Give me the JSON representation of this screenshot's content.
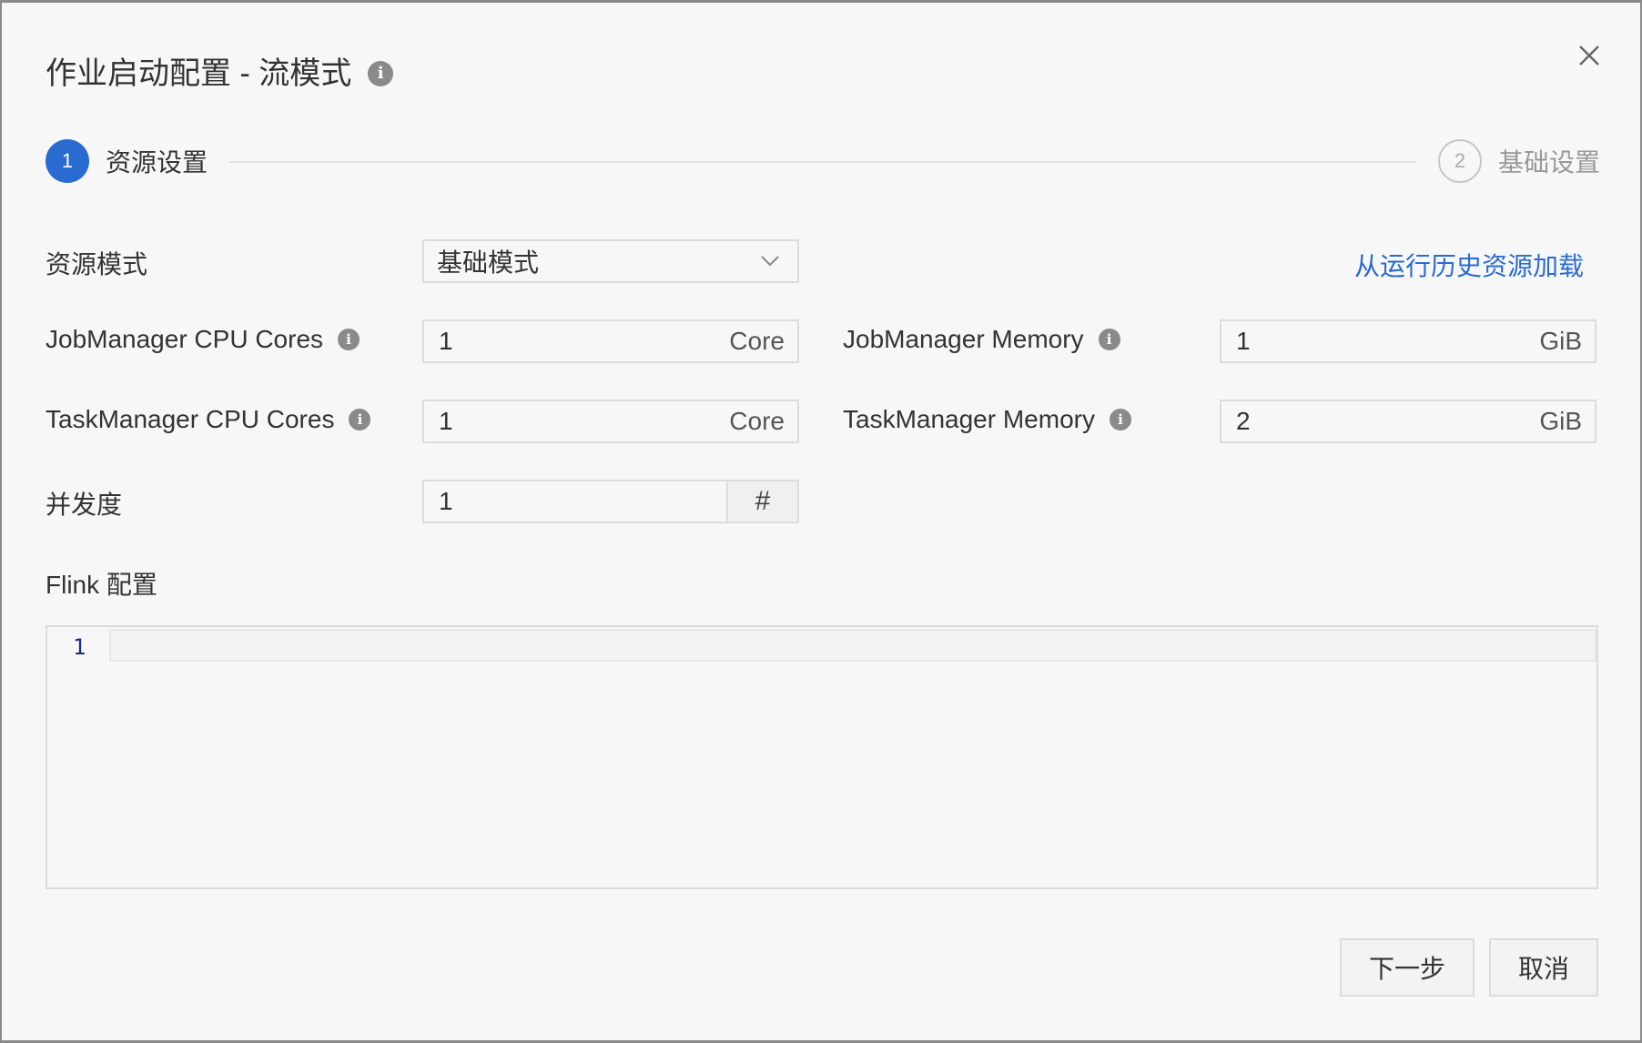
{
  "dialog": {
    "title": "作业启动配置 - 流模式",
    "title_info_icon": "info-icon",
    "close_icon": "close-icon"
  },
  "steps": [
    {
      "number": "1",
      "label": "资源设置",
      "active": true
    },
    {
      "number": "2",
      "label": "基础设置",
      "active": false
    }
  ],
  "form": {
    "resource_mode": {
      "label": "资源模式",
      "value": "基础模式",
      "icon": "chevron-down-icon"
    },
    "load_history_link": "从运行历史资源加载",
    "jm_cpu": {
      "label": "JobManager CPU Cores",
      "value": "1",
      "unit": "Core"
    },
    "jm_memory": {
      "label": "JobManager Memory",
      "value": "1",
      "unit": "GiB"
    },
    "tm_cpu": {
      "label": "TaskManager CPU Cores",
      "value": "1",
      "unit": "Core"
    },
    "tm_memory": {
      "label": "TaskManager Memory",
      "value": "2",
      "unit": "GiB"
    },
    "parallelism": {
      "label": "并发度",
      "value": "1",
      "button_symbol": "#"
    },
    "flink_config": {
      "label": "Flink 配置",
      "line_number": "1"
    }
  },
  "footer": {
    "next_label": "下一步",
    "cancel_label": "取消"
  },
  "colors": {
    "accent": "#2a6bd1",
    "info_icon": "#8a8a8a"
  }
}
